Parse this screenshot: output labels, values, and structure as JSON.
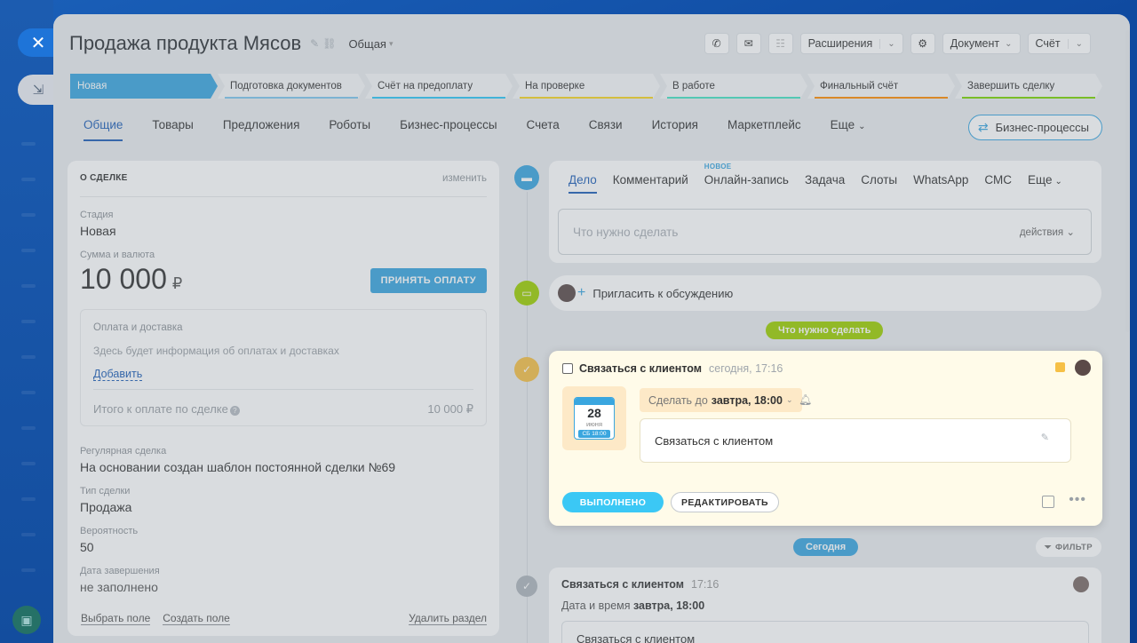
{
  "deal": {
    "title": "Продажа продукта Мясов",
    "category": "Общая"
  },
  "toolbar": {
    "extensions": "Расширения",
    "document": "Документ",
    "invoice": "Счёт"
  },
  "stages": [
    {
      "label": "Новая",
      "color": "#3aa6df",
      "active": true
    },
    {
      "label": "Подготовка документов",
      "color": "#7fc7ee"
    },
    {
      "label": "Счёт на предоплату",
      "color": "#2fc6f6"
    },
    {
      "label": "На проверке",
      "color": "#f7d622"
    },
    {
      "label": "В работе",
      "color": "#47e4c2"
    },
    {
      "label": "Финальный счёт",
      "color": "#ff8b00"
    },
    {
      "label": "Завершить сделку",
      "color": "#7bd500"
    }
  ],
  "tabs": [
    {
      "label": "Общие",
      "active": true
    },
    {
      "label": "Товары"
    },
    {
      "label": "Предложения"
    },
    {
      "label": "Роботы"
    },
    {
      "label": "Бизнес-процессы"
    },
    {
      "label": "Счета"
    },
    {
      "label": "Связи"
    },
    {
      "label": "История"
    },
    {
      "label": "Маркетплейс"
    },
    {
      "label": "Еще"
    }
  ],
  "bp_button": "Бизнес-процессы",
  "about": {
    "heading": "О СДЕЛКЕ",
    "edit": "изменить",
    "stage_label": "Стадия",
    "stage_value": "Новая",
    "sum_label": "Сумма и валюта",
    "sum_value": "10 000",
    "currency": "₽",
    "pay_button": "ПРИНЯТЬ ОПЛАТУ",
    "payment": {
      "title": "Оплата и доставка",
      "desc": "Здесь будет информация об оплатах и доставках",
      "add": "Добавить",
      "total_label": "Итого к оплате по сделке",
      "total_value": "10 000 ₽"
    },
    "recurring_label": "Регулярная сделка",
    "recurring_value": "На основании создан шаблон постоянной сделки №69",
    "type_label": "Тип сделки",
    "type_value": "Продажа",
    "prob_label": "Вероятность",
    "prob_value": "50",
    "close_label": "Дата завершения",
    "close_value": "не заполнено",
    "footer": {
      "select_field": "Выбрать поле",
      "create_field": "Создать поле",
      "delete_section": "Удалить раздел"
    }
  },
  "composer": {
    "tabs": [
      "Дело",
      "Комментарий",
      "Онлайн-запись",
      "Задача",
      "Слоты",
      "WhatsApp",
      "СМС",
      "Еще"
    ],
    "new_badge": "НОВОЕ",
    "placeholder": "Что нужно сделать",
    "actions": "действия"
  },
  "invite": "Пригласить к обсуждению",
  "pills": {
    "todo": "Что нужно сделать",
    "today": "Сегодня",
    "filter": "ФИЛЬТР"
  },
  "activity": {
    "title": "Связаться с клиентом",
    "time": "сегодня, 17:16",
    "cal_day": "28",
    "cal_month": "июня",
    "cal_time": "СБ 18:00",
    "deadline_prefix": "Сделать до",
    "deadline_value": "завтра, 18:00",
    "description": "Связаться с клиентом",
    "done": "ВЫПОЛНЕНО",
    "edit": "РЕДАКТИРОВАТЬ"
  },
  "history": {
    "title": "Связаться с клиентом",
    "time": "17:16",
    "date_label": "Дата и время",
    "date_value": "завтра, 18:00",
    "text": "Связаться с клиентом"
  }
}
